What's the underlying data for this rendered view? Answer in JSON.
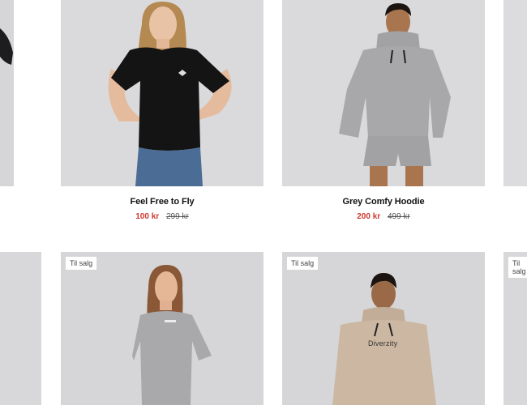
{
  "products": [
    {
      "title": "Feel Free to Fly",
      "sale_price": "100 kr",
      "original_price": "299 kr",
      "badge": ""
    },
    {
      "title": "Grey Comfy Hoodie",
      "sale_price": "200 kr",
      "original_price": "499 kr",
      "badge": ""
    },
    {
      "badge": "Til salg"
    },
    {
      "badge": "Til salg",
      "print_text": "Diverzity"
    },
    {
      "badge": "Til salg"
    }
  ],
  "colors": {
    "sale_price": "#d0382f",
    "photo_background": "#dcdcde"
  }
}
